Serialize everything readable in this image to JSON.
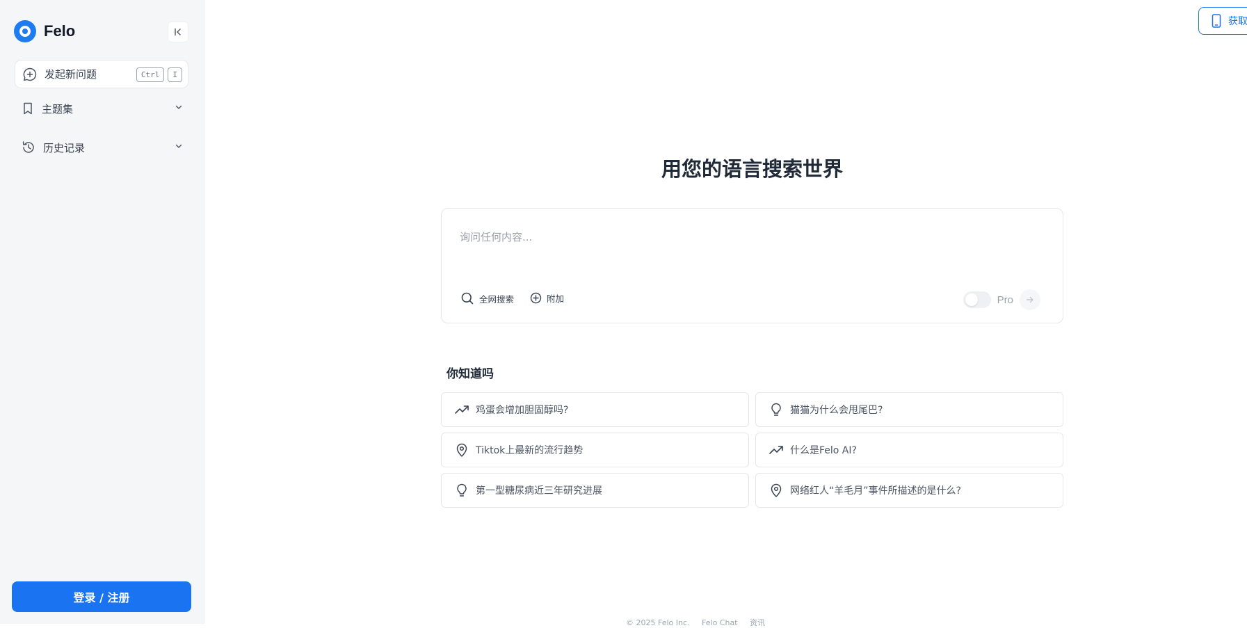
{
  "brand": {
    "name": "Felo"
  },
  "sidebar": {
    "new_question": {
      "label": "发起新问题",
      "shortcut": [
        "Ctrl",
        "I"
      ]
    },
    "items": [
      {
        "label": "主题集"
      },
      {
        "label": "历史记录"
      }
    ],
    "login_label": "登录 / 注册"
  },
  "header": {
    "get_app_label": "获取"
  },
  "main": {
    "headline": "用您的语言搜索世界",
    "search": {
      "placeholder": "询问任何内容...",
      "web_search_label": "全网搜索",
      "attach_label": "附加",
      "pro_label": "Pro",
      "pro_enabled": false
    },
    "did_you_know": {
      "title": "你知道吗",
      "cards": [
        {
          "icon": "trending-up-icon",
          "label": "鸡蛋会增加胆固醇吗?"
        },
        {
          "icon": "lightbulb-icon",
          "label": "猫猫为什么会甩尾巴?"
        },
        {
          "icon": "map-pin-icon",
          "label": "Tiktok上最新的流行趋势"
        },
        {
          "icon": "trending-up-icon",
          "label": "什么是Felo AI?"
        },
        {
          "icon": "lightbulb-icon",
          "label": "第一型糖尿病近三年研究进展"
        },
        {
          "icon": "map-pin-icon",
          "label": "网络红人“羊毛月”事件所描述的是什么?"
        }
      ]
    }
  },
  "footer": {
    "copyright": "© 2025 Felo Inc.",
    "chat_label": "Felo Chat",
    "news_label": "资讯"
  },
  "colors": {
    "accent": "#1a73f0",
    "sidebar_bg": "#f5f6f8",
    "border": "#e5e7eb"
  }
}
